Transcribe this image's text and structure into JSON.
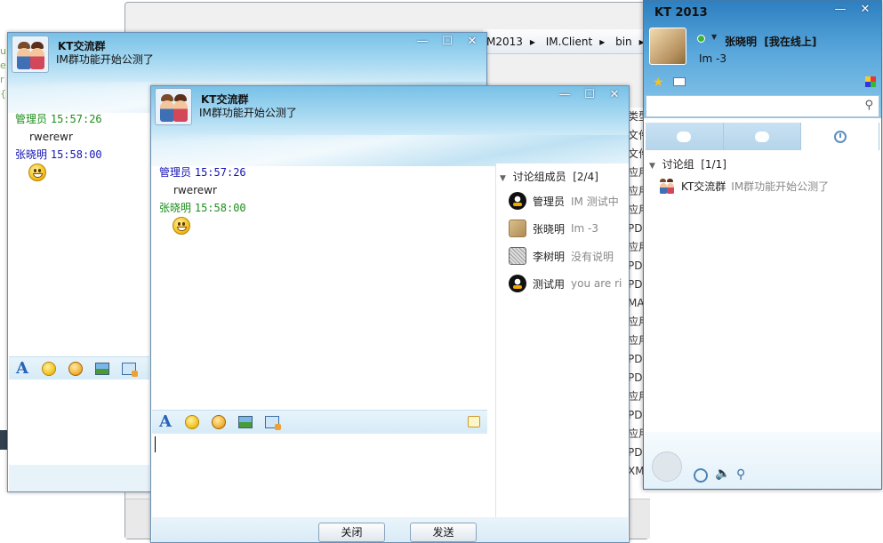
{
  "background": {
    "breadcrumb": [
      "M2013",
      "IM.Client",
      "bin"
    ],
    "breadcrumb_sep": "▸",
    "file_fragments": [
      "类型",
      "文件",
      "文件",
      "应用",
      "应用",
      "应用",
      "PD",
      "应用",
      "PD",
      "PD",
      "MA",
      "应用",
      "应用",
      "PD",
      "PD",
      "应用",
      "PD",
      "应用",
      "PD",
      "XM"
    ],
    "editor_glyphs": [
      "u",
      "e",
      "",
      "r",
      "{"
    ]
  },
  "chat_back": {
    "title": "KT交流群",
    "subtitle": "IM群功能开始公测了",
    "window_controls": [
      "—",
      "☐",
      "✕"
    ],
    "messages": [
      {
        "sender": "管理员",
        "time": "15:57:26",
        "text": "rwerewr",
        "kind": "admin"
      },
      {
        "sender": "张晓明",
        "time": "15:58:00",
        "text": "",
        "emoji": "grin-emoticon",
        "kind": "zxm"
      }
    ]
  },
  "chat_front": {
    "title": "KT交流群",
    "subtitle": "IM群功能开始公测了",
    "window_controls": [
      "—",
      "☐",
      "✕"
    ],
    "messages": [
      {
        "sender": "管理员",
        "time": "15:57:26",
        "text": "rwerewr",
        "kind": "zxm"
      },
      {
        "sender": "张晓明",
        "time": "15:58:00",
        "text": "",
        "emoji": "grin-emoticon",
        "kind": "admin"
      }
    ],
    "toolbar": {
      "font_glyph": "A"
    },
    "members_header": "讨论组成员",
    "members_count": "[2/4]",
    "members": [
      {
        "name": "管理员",
        "signature": "IM 测试中",
        "avatar": "qq-penguin-icon"
      },
      {
        "name": "张晓明",
        "signature": "Im -3",
        "avatar": "photo-avatar"
      },
      {
        "name": "李树明",
        "signature": "没有说明",
        "avatar": "sketch-avatar"
      },
      {
        "name": "测试用",
        "signature": "you are ri",
        "avatar": "qq-penguin-icon"
      }
    ],
    "close_label": "关闭",
    "send_label": "发送"
  },
  "main_panel": {
    "app_title": "KT 2013",
    "window_controls": [
      "—",
      "✕"
    ],
    "username": "张晓明",
    "status": "[我在线上]",
    "signature": "Im -3",
    "search_placeholder": "",
    "group_header": "讨论组",
    "group_count": "[1/1]",
    "groups": [
      {
        "name": "KT交流群",
        "notice": "IM群功能开始公测了"
      }
    ]
  }
}
